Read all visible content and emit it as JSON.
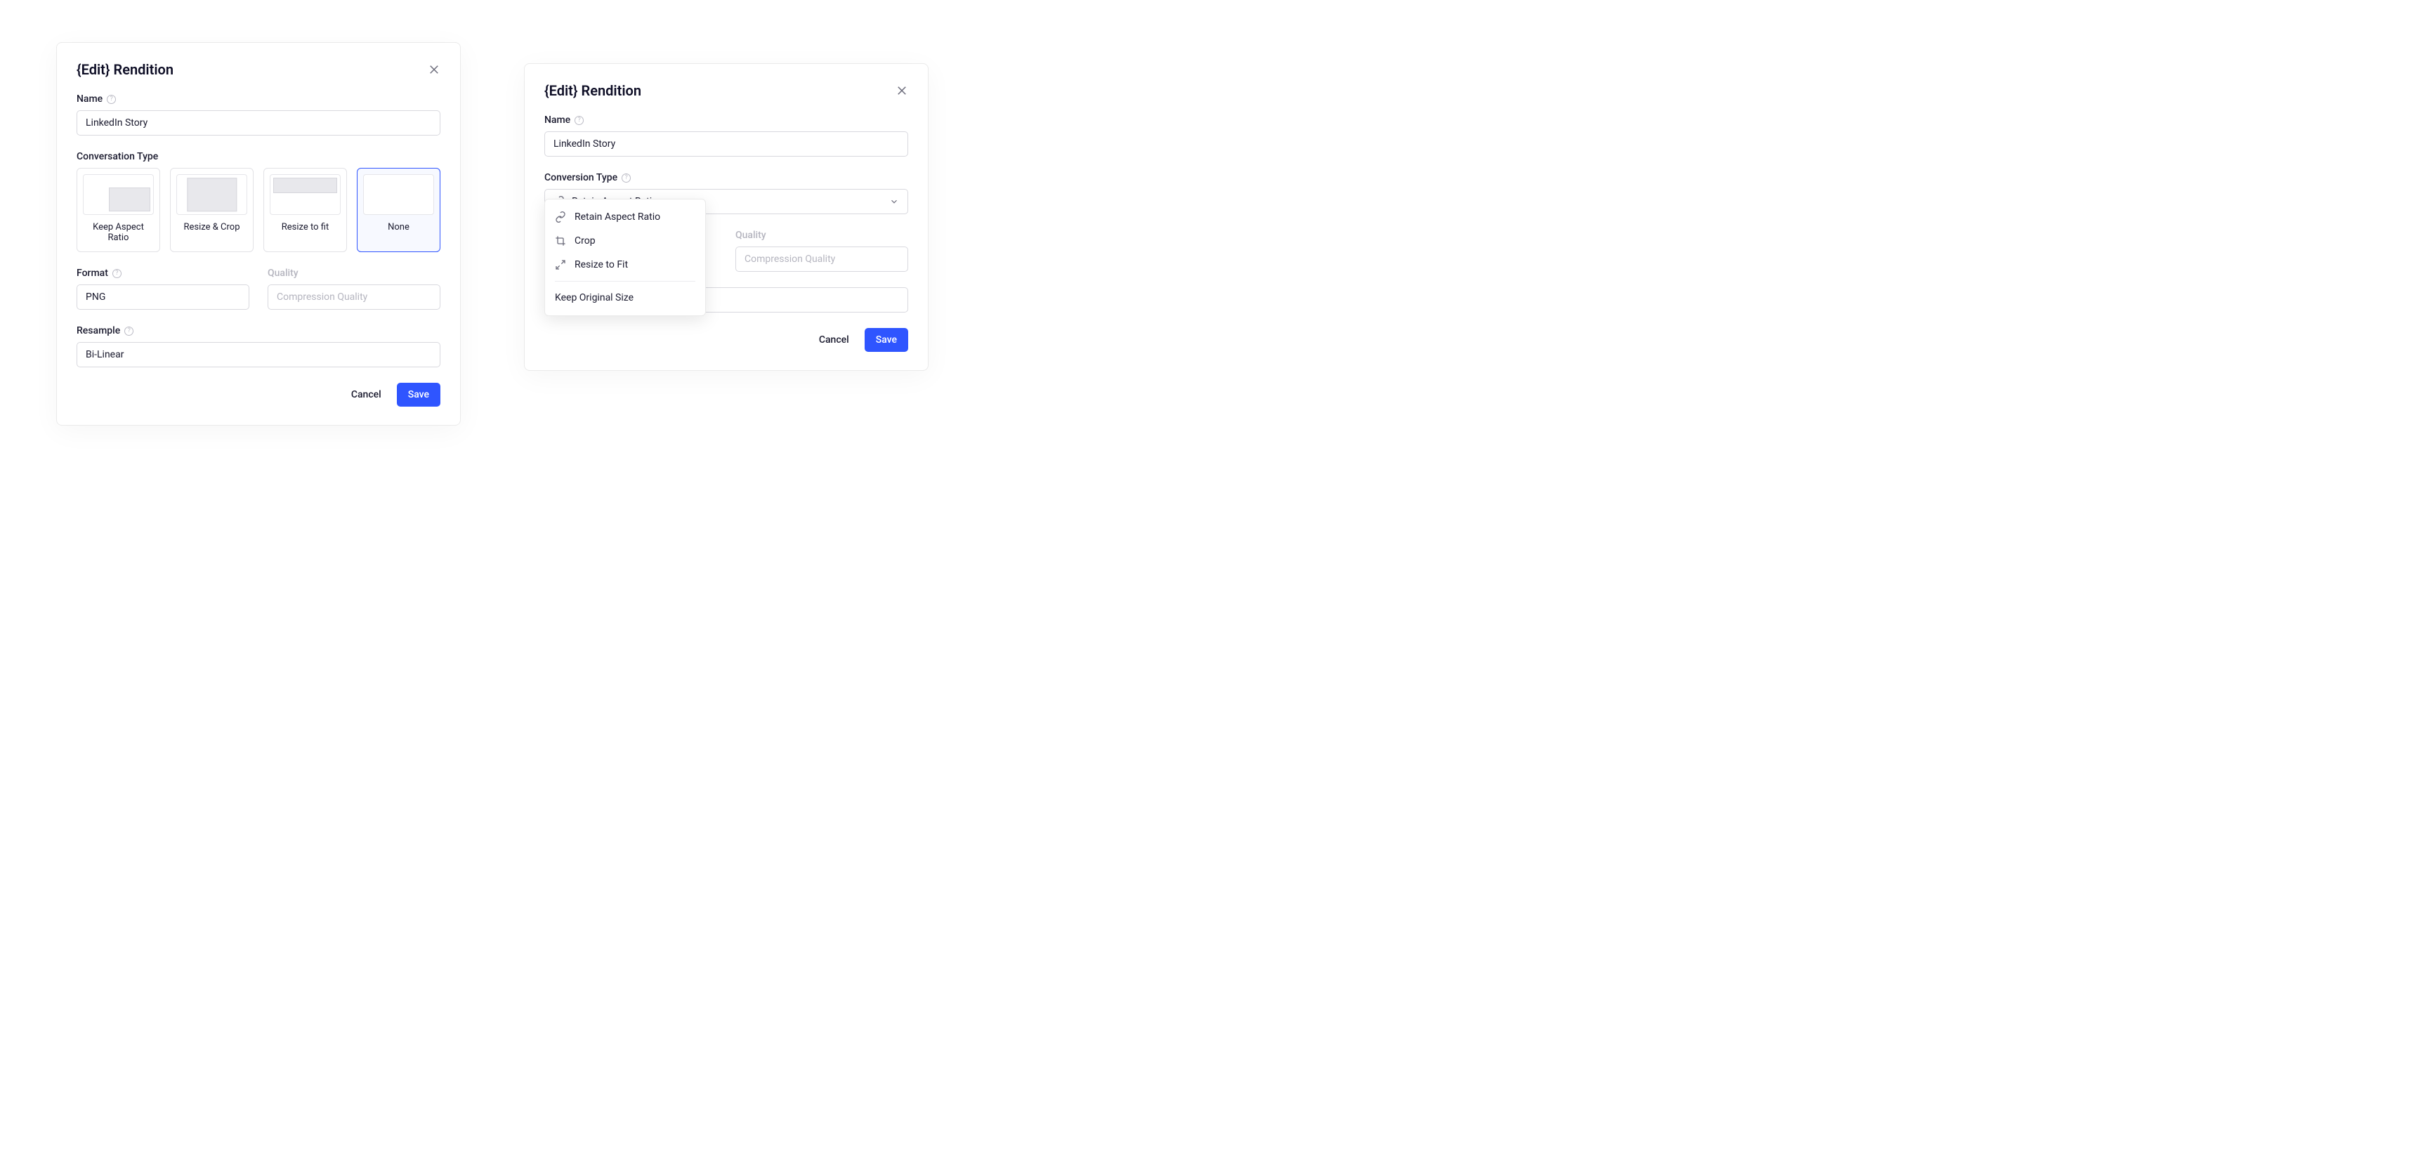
{
  "dialog1": {
    "title": "{Edit} Rendition",
    "name_label": "Name",
    "name_value": "LinkedIn Story",
    "conversation_type_label": "Conversation Type",
    "tiles": [
      {
        "label": "Keep Aspect Ratio"
      },
      {
        "label": "Resize & Crop"
      },
      {
        "label": "Resize to fit"
      },
      {
        "label": "None"
      }
    ],
    "format_label": "Format",
    "format_value": "PNG",
    "quality_label": "Quality",
    "quality_placeholder": "Compression Quality",
    "resample_label": "Resample",
    "resample_value": "Bi-Linear",
    "cancel_label": "Cancel",
    "save_label": "Save"
  },
  "dialog2": {
    "title": "{Edit} Rendition",
    "name_label": "Name",
    "name_value": "LinkedIn Story",
    "conversion_type_label": "Conversion Type",
    "conversion_selected": "Retain Aspect Ratio",
    "dropdown_options": [
      "Retain Aspect Ratio",
      "Crop",
      "Resize to Fit"
    ],
    "dropdown_footer_option": "Keep Original Size",
    "quality_label": "Quality",
    "quality_placeholder": "Compression Quality",
    "cancel_label": "Cancel",
    "save_label": "Save"
  }
}
